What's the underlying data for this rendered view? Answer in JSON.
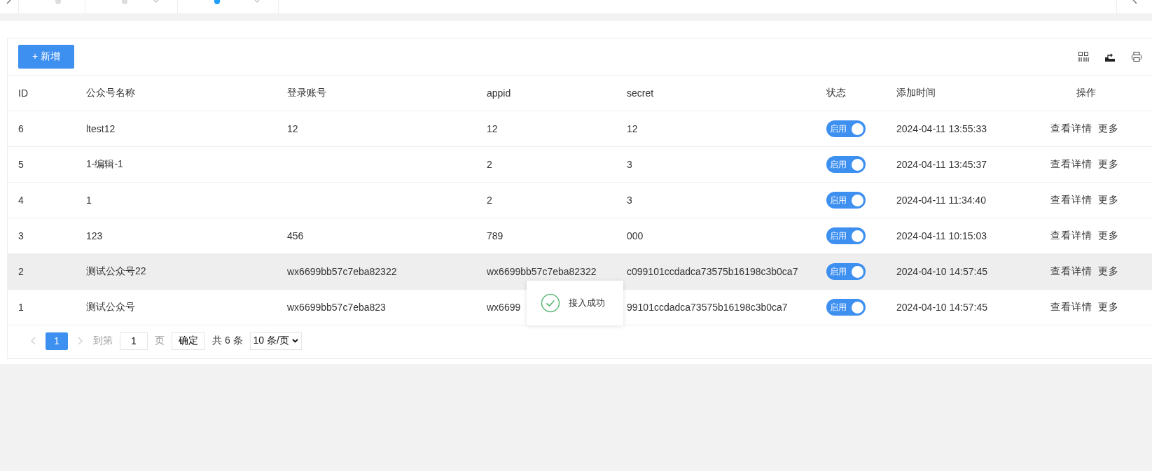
{
  "tabs": [
    {
      "selected": false,
      "closable": false
    },
    {
      "selected": false,
      "closable": true
    },
    {
      "selected": true,
      "closable": true
    }
  ],
  "toolbar": {
    "add_button": "+ 新增"
  },
  "table": {
    "columns": [
      "ID",
      "公众号名称",
      "登录账号",
      "appid",
      "secret",
      "状态",
      "添加时间",
      "操作"
    ],
    "rows": [
      {
        "id": "6",
        "name": "ltest12",
        "account": "12",
        "appid": "12",
        "secret": "12",
        "status": {
          "label": "启用",
          "on": true
        },
        "time": "2024-04-11 13:55:33",
        "actions": [
          "查看详情",
          "更多"
        ],
        "hovered": false
      },
      {
        "id": "5",
        "name": "1-编辑-1",
        "account": "",
        "appid": "2",
        "secret": "3",
        "status": {
          "label": "启用",
          "on": true
        },
        "time": "2024-04-11 13:45:37",
        "actions": [
          "查看详情",
          "更多"
        ],
        "hovered": false
      },
      {
        "id": "4",
        "name": "1",
        "account": "",
        "appid": "2",
        "secret": "3",
        "status": {
          "label": "启用",
          "on": true
        },
        "time": "2024-04-11 11:34:40",
        "actions": [
          "查看详情",
          "更多"
        ],
        "hovered": false
      },
      {
        "id": "3",
        "name": "123",
        "account": "456",
        "appid": "789",
        "secret": "000",
        "status": {
          "label": "启用",
          "on": true
        },
        "time": "2024-04-11 10:15:03",
        "actions": [
          "查看详情",
          "更多"
        ],
        "hovered": false
      },
      {
        "id": "2",
        "name": "测试公众号22",
        "account": "wx6699bb57c7eba82322",
        "appid": "wx6699bb57c7eba82322",
        "secret": "c099101ccdadca73575b16198c3b0ca7",
        "status": {
          "label": "启用",
          "on": true
        },
        "time": "2024-04-10 14:57:45",
        "actions": [
          "查看详情",
          "更多"
        ],
        "hovered": true
      },
      {
        "id": "1",
        "name": "测试公众号",
        "account": "wx6699bb57c7eba823",
        "appid": "wx6699",
        "secret": "99101ccdadca73575b16198c3b0ca7",
        "status": {
          "label": "启用",
          "on": true
        },
        "time": "2024-04-10 14:57:45",
        "actions": [
          "查看详情",
          "更多"
        ],
        "hovered": false
      }
    ]
  },
  "pagination": {
    "pages": [
      {
        "label": "1",
        "selected": true
      }
    ],
    "goto_label": "到第",
    "page_input": "1",
    "page_unit": "页",
    "confirm": "确定",
    "total": "共 6 条",
    "page_size": "10 条/页"
  },
  "toast": {
    "message": "接入成功"
  }
}
